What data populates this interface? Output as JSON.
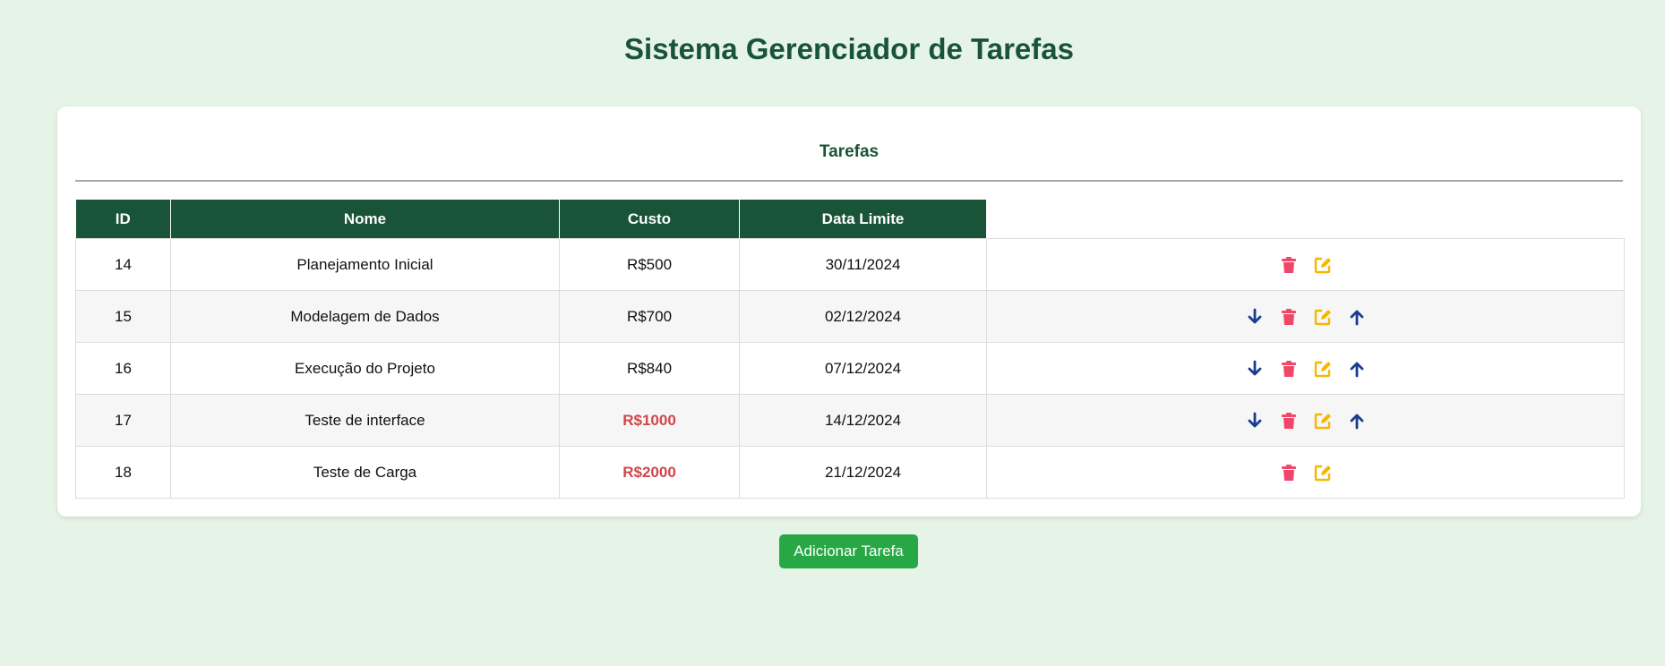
{
  "page": {
    "title": "Sistema Gerenciador de Tarefas"
  },
  "card": {
    "title": "Tarefas"
  },
  "table": {
    "headers": [
      "ID",
      "Nome",
      "Custo",
      "Data Limite"
    ],
    "rows": [
      {
        "id": "14",
        "nome": "Planejamento Inicial",
        "custo": "R$500",
        "data": "30/11/2024",
        "highlight": false,
        "move_down": false,
        "move_up": false
      },
      {
        "id": "15",
        "nome": "Modelagem de Dados",
        "custo": "R$700",
        "data": "02/12/2024",
        "highlight": false,
        "move_down": true,
        "move_up": true
      },
      {
        "id": "16",
        "nome": "Execução do Projeto",
        "custo": "R$840",
        "data": "07/12/2024",
        "highlight": false,
        "move_down": true,
        "move_up": true
      },
      {
        "id": "17",
        "nome": "Teste de interface",
        "custo": "R$1000",
        "data": "14/12/2024",
        "highlight": true,
        "move_down": true,
        "move_up": true
      },
      {
        "id": "18",
        "nome": "Teste de Carga",
        "custo": "R$2000",
        "data": "21/12/2024",
        "highlight": true,
        "move_down": false,
        "move_up": false
      }
    ]
  },
  "actions": {
    "add_label": "Adicionar Tarefa"
  },
  "icons": {
    "move_down": "arrow-down-icon",
    "delete": "trash-icon",
    "edit": "edit-icon",
    "move_up": "arrow-up-icon"
  },
  "colors": {
    "primary": "#195438",
    "background": "#e6f4e7",
    "arrow": "#1a3d8f",
    "delete": "#f0466a",
    "edit": "#f5b800",
    "over_budget": "#d0464a",
    "add_button": "#28a745"
  }
}
